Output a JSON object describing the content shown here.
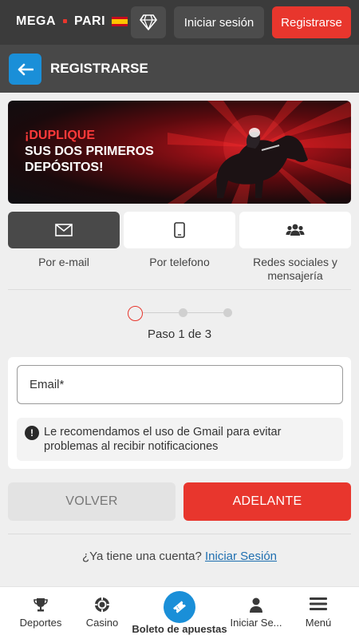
{
  "header": {
    "logo_left": "MEGA",
    "logo_right": "PARI",
    "login_label": "Iniciar sesión",
    "register_label": "Registrarse"
  },
  "subheader": {
    "title": "REGISTRARSE"
  },
  "banner": {
    "line1": "¡DUPLIQUE",
    "line2": "SUS DOS PRIMEROS",
    "line3": "DEPÓSITOS!"
  },
  "methods": [
    {
      "label": "Por e-mail",
      "icon": "envelope-icon",
      "active": true
    },
    {
      "label": "Por telefono",
      "icon": "phone-icon",
      "active": false
    },
    {
      "label": "Redes sociales y mensajería",
      "icon": "users-icon",
      "active": false
    }
  ],
  "steps": {
    "current": 1,
    "total": 3,
    "label": "Paso 1 de 3"
  },
  "form": {
    "email_placeholder": "Email*",
    "notice": "Le recomendamos el uso de Gmail para evitar problemas al recibir notificaciones"
  },
  "actions": {
    "back": "VOLVER",
    "next": "ADELANTE"
  },
  "account": {
    "question": "¿Ya tiene una cuenta?",
    "link": "Iniciar Sesión"
  },
  "bottom_nav": {
    "sports": "Deportes",
    "casino": "Casino",
    "betslip": "Boleto de apuestas",
    "login": "Iniciar Se...",
    "menu": "Menú"
  },
  "colors": {
    "accent_red": "#e8362d",
    "accent_blue": "#1a8fd8",
    "header_bg": "#3b3b3b"
  }
}
